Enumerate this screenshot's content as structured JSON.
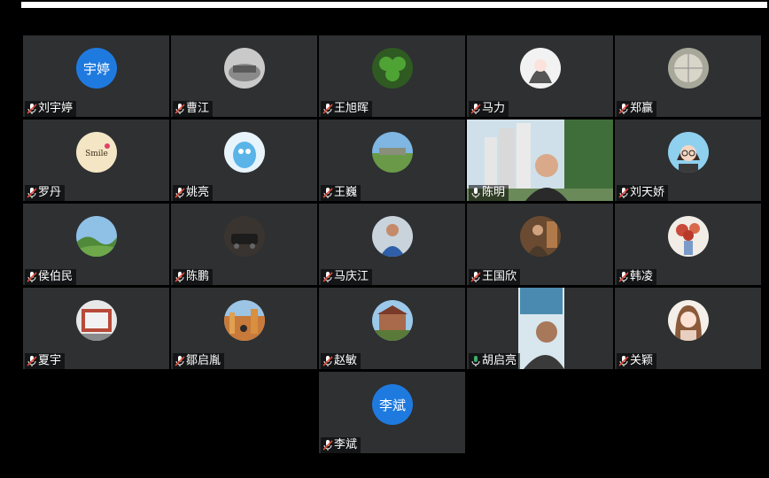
{
  "participants": [
    {
      "name": "刘宇婷",
      "avatar": "initials",
      "initials": "宇婷",
      "mic": "muted"
    },
    {
      "name": "曹江",
      "avatar": "photo",
      "mic": "muted"
    },
    {
      "name": "王旭晖",
      "avatar": "photo",
      "mic": "muted"
    },
    {
      "name": "马力",
      "avatar": "photo",
      "mic": "muted"
    },
    {
      "name": "郑赢",
      "avatar": "photo",
      "mic": "muted"
    },
    {
      "name": "罗丹",
      "avatar": "photo",
      "mic": "muted"
    },
    {
      "name": "姚亮",
      "avatar": "photo",
      "mic": "muted"
    },
    {
      "name": "王巍",
      "avatar": "photo",
      "mic": "muted"
    },
    {
      "name": "陈明",
      "avatar": "video",
      "mic": "on"
    },
    {
      "name": "刘天娇",
      "avatar": "photo",
      "mic": "muted"
    },
    {
      "name": "侯伯民",
      "avatar": "photo",
      "mic": "muted"
    },
    {
      "name": "陈鹏",
      "avatar": "photo",
      "mic": "muted"
    },
    {
      "name": "马庆江",
      "avatar": "photo",
      "mic": "muted"
    },
    {
      "name": "王国欣",
      "avatar": "photo",
      "mic": "muted"
    },
    {
      "name": "韩凌",
      "avatar": "photo",
      "mic": "muted"
    },
    {
      "name": "夏宇",
      "avatar": "photo",
      "mic": "muted"
    },
    {
      "name": "鄒启胤",
      "avatar": "photo",
      "mic": "muted"
    },
    {
      "name": "赵敏",
      "avatar": "photo",
      "mic": "muted"
    },
    {
      "name": "胡启亮",
      "avatar": "video",
      "mic": "speaking"
    },
    {
      "name": "关颖",
      "avatar": "photo",
      "mic": "muted"
    },
    {
      "name": "李斌",
      "avatar": "initials",
      "initials": "李斌",
      "mic": "muted"
    }
  ],
  "colors": {
    "tile_bg": "#2e3032",
    "initials_bg": "#1f7ae0",
    "mic_muted": "#e04a3a",
    "mic_on": "#ffffff",
    "speaking_border": "#3fae6b"
  }
}
